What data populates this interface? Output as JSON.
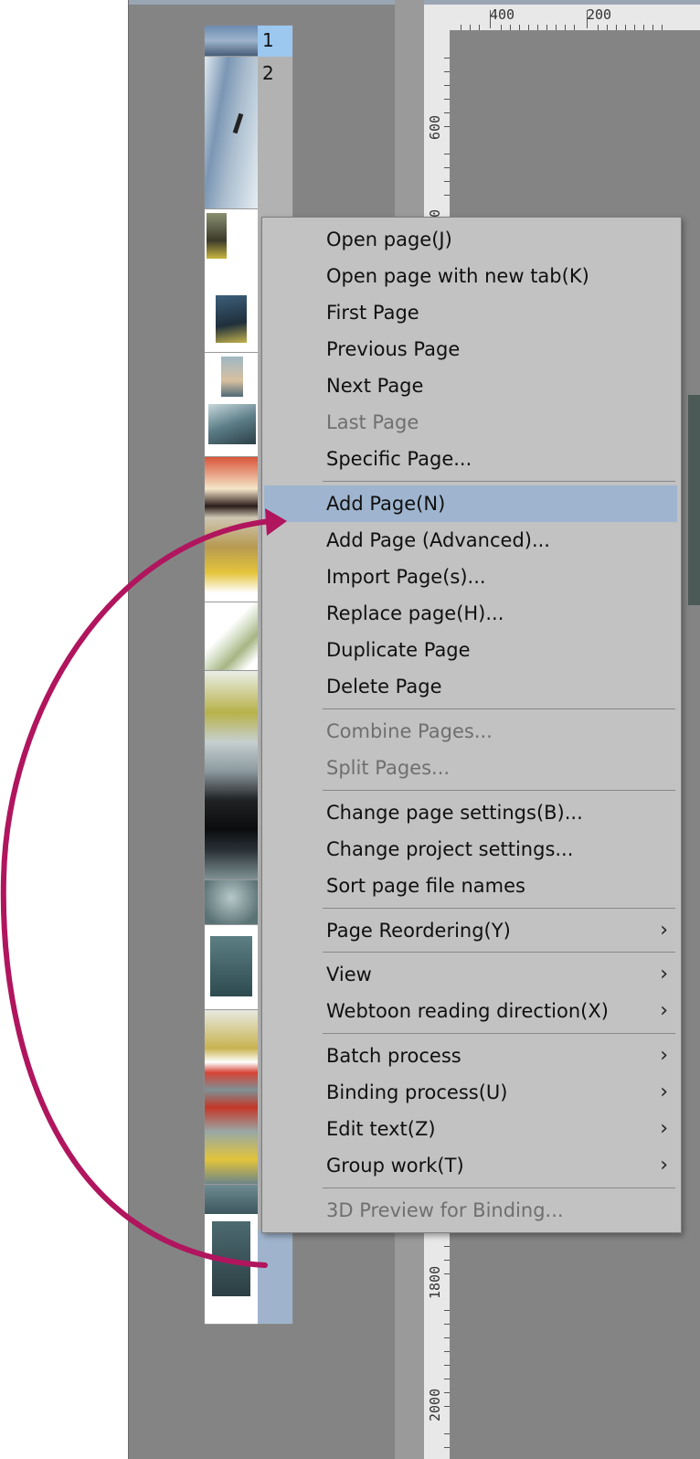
{
  "page_list": {
    "numbers": [
      "1",
      "2"
    ]
  },
  "ruler": {
    "top_labels": [
      "400",
      "200"
    ],
    "left_labels": [
      "600",
      "0",
      "1800",
      "2000"
    ]
  },
  "menu": {
    "items": [
      {
        "label": "Open page(J)",
        "disabled": false
      },
      {
        "label": "Open page with new tab(K)",
        "disabled": false
      },
      {
        "label": "First Page",
        "disabled": false
      },
      {
        "label": "Previous Page",
        "disabled": false
      },
      {
        "label": "Next Page",
        "disabled": false
      },
      {
        "label": "Last Page",
        "disabled": true
      },
      {
        "label": "Specific Page...",
        "disabled": false
      },
      {
        "label": "Add Page(N)",
        "disabled": false,
        "highlighted": true
      },
      {
        "label": "Add Page (Advanced)...",
        "disabled": false
      },
      {
        "label": "Import Page(s)...",
        "disabled": false
      },
      {
        "label": "Replace page(H)...",
        "disabled": false
      },
      {
        "label": "Duplicate Page",
        "disabled": false
      },
      {
        "label": "Delete Page",
        "disabled": false
      },
      {
        "label": "Combine Pages...",
        "disabled": true
      },
      {
        "label": "Split Pages...",
        "disabled": true
      },
      {
        "label": "Change page settings(B)...",
        "disabled": false
      },
      {
        "label": "Change project settings...",
        "disabled": false
      },
      {
        "label": "Sort page file names",
        "disabled": false
      },
      {
        "label": "Page Reordering(Y)",
        "disabled": false,
        "submenu": true
      },
      {
        "label": "View",
        "disabled": false,
        "submenu": true
      },
      {
        "label": "Webtoon reading direction(X)",
        "disabled": false,
        "submenu": true
      },
      {
        "label": "Batch process",
        "disabled": false,
        "submenu": true
      },
      {
        "label": "Binding process(U)",
        "disabled": false,
        "submenu": true
      },
      {
        "label": "Edit text(Z)",
        "disabled": false,
        "submenu": true
      },
      {
        "label": "Group work(T)",
        "disabled": false,
        "submenu": true
      },
      {
        "label": "3D Preview for Binding...",
        "disabled": true
      }
    ],
    "submenu_glyph": "›"
  },
  "colors": {
    "annotation_arrow": "#b0155e",
    "highlight": "#9fb5cf"
  }
}
